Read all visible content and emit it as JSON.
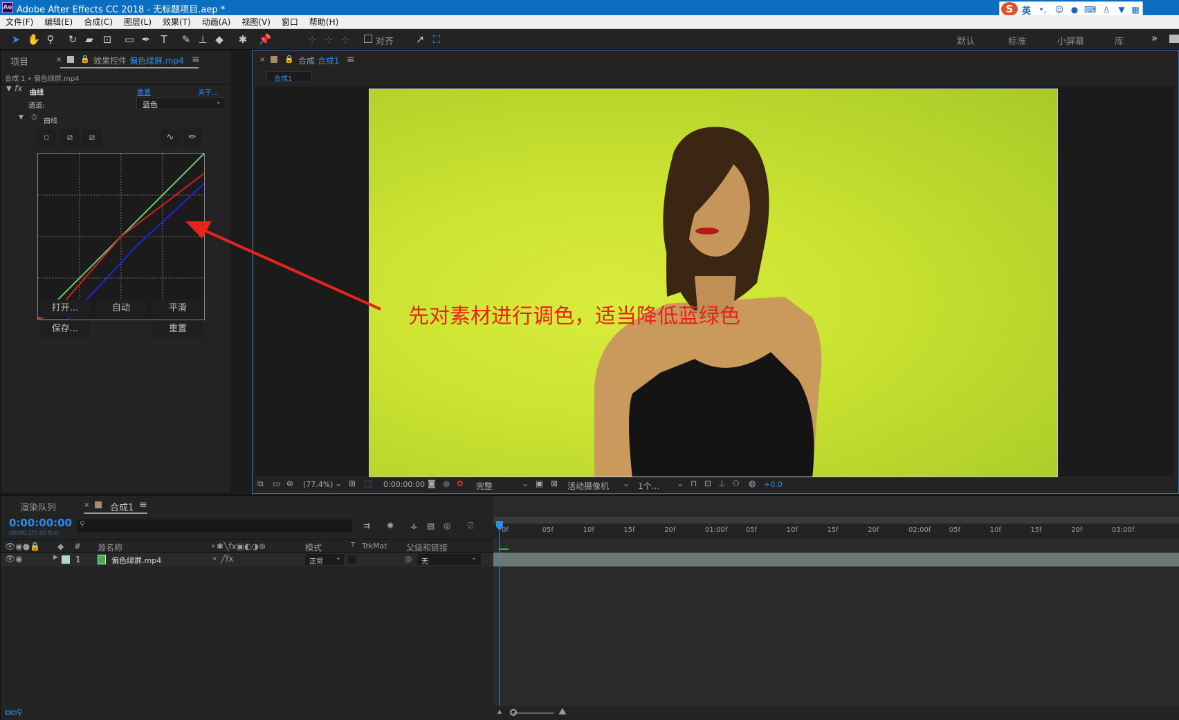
{
  "window": {
    "title": "Adobe After Effects CC 2018 - 无标题项目.aep *",
    "app_icon": "Ae"
  },
  "ime": {
    "lang": "英",
    "icons": [
      "moon-dot-icon",
      "smile-icon",
      "mic-icon",
      "keyboard-icon",
      "user-icon",
      "shirt-icon",
      "grid-icon"
    ]
  },
  "menu": [
    "文件(F)",
    "编辑(E)",
    "合成(C)",
    "图层(L)",
    "效果(T)",
    "动画(A)",
    "视图(V)",
    "窗口",
    "帮助(H)"
  ],
  "toolbar": {
    "snap_label": "对齐",
    "workspaces": [
      "默认",
      "标准",
      "小屏幕",
      "库"
    ],
    "overflow": "»"
  },
  "project_panel": {
    "tab_project": "项目",
    "tab_effects_prefix": "效果控件",
    "tab_effects_file": "偏色绿屏.mp4",
    "breadcrumb": "合成 1 • 偏色绿屏.mp4"
  },
  "effect": {
    "fx": "fx",
    "name": "曲线",
    "reset": "重置",
    "about": "关于...",
    "channel_label": "通道:",
    "channel_value": "蓝色",
    "curves_label": "曲线"
  },
  "curve_buttons": {
    "open": "打开...",
    "auto": "自动",
    "smooth": "平滑",
    "save": "保存...",
    "reset": "重置"
  },
  "curve_data": {
    "type": "line",
    "series": [
      {
        "color": "#6fcf70",
        "points": [
          [
            0,
            0
          ],
          [
            1,
            1
          ]
        ]
      },
      {
        "color": "#d22020",
        "points": [
          [
            0,
            0
          ],
          [
            0.1,
            0.04
          ],
          [
            0.5,
            0.5
          ],
          [
            1,
            0.88
          ]
        ]
      },
      {
        "color": "#2222e8",
        "points": [
          [
            0,
            0
          ],
          [
            0.18,
            0
          ],
          [
            0.6,
            0.45
          ],
          [
            1,
            0.82
          ]
        ]
      }
    ]
  },
  "viewer": {
    "tab_prefix": "合成",
    "tab_name": "合成1",
    "sub_tab": "合成1",
    "annotation": "先对素材进行调色，适当降低蓝绿色"
  },
  "viewer_bar": {
    "zoom": "(77.4%)",
    "timecode": "0:00:00:00",
    "resolution": "完整",
    "camera": "活动摄像机",
    "views": "1个...",
    "exposure": "+0.0"
  },
  "render_queue": {
    "tab": "渲染队列"
  },
  "timeline": {
    "tab": "合成1",
    "timecode": "0:00:00:00",
    "frames_fps": "00000 (25.00 fps)",
    "search_placeholder": "",
    "cols": {
      "num": "#",
      "source": "源名称",
      "mode": "模式",
      "t": "T",
      "trkmat": "TrkMat",
      "parent": "父级和链接"
    },
    "layer": {
      "index": "1",
      "name": "偏色绿屏.mp4",
      "mode": "正常",
      "parent": "无"
    },
    "ruler": [
      "0f",
      "05f",
      "10f",
      "15f",
      "20f",
      "01:00f",
      "05f",
      "10f",
      "15f",
      "20f",
      "02:00f",
      "05f",
      "10f",
      "15f",
      "20f",
      "03:00f"
    ]
  },
  "colors": {
    "accent": "#2d8ceb",
    "title_bar": "#0a6fc1",
    "annotation": "#e8231b",
    "arrow": "#e8231b",
    "layer_label": "#b5d5d0"
  }
}
